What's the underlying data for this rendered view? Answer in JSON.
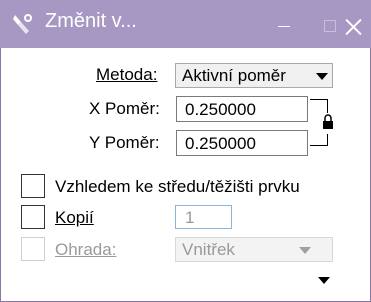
{
  "window": {
    "title": "Změnit v...",
    "icon": "settings-icon",
    "accent_color": "#a698c2"
  },
  "form": {
    "method_label": "Metoda:",
    "method_value": "Aktivní poměr",
    "x_label": "X Poměr:",
    "x_value": "0.250000",
    "y_label": "Y Poměr:",
    "y_value": "0.250000",
    "centroid_label": "Vzhledem ke středu/těžišti prvku",
    "copies_label": "Kopií",
    "copies_value": "1",
    "fence_label": "Ohrada:",
    "fence_value": "Vnitřek"
  }
}
